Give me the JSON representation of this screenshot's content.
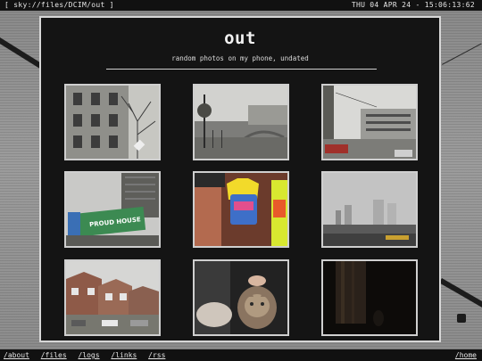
{
  "topbar": {
    "path": "[ sky://files/DCIM/out ]",
    "clock": "THU 04 APR 24 - 15:06:13:62"
  },
  "header": {
    "title": "out",
    "subtitle": "random photos on my phone, undated"
  },
  "photos": [
    {
      "subject": "old building with bare tree"
    },
    {
      "subject": "canal with bridge"
    },
    {
      "subject": "street with buildings"
    },
    {
      "subject": "building with sign",
      "sign_text": "PROUD HOUSE"
    },
    {
      "subject": "shop window with bag"
    },
    {
      "subject": "foggy skyline"
    },
    {
      "subject": "terraced houses street"
    },
    {
      "subject": "cat on lap"
    },
    {
      "subject": "dark room"
    }
  ],
  "nav": {
    "links": [
      "/about",
      "/files",
      "/logs",
      "/links",
      "/rss"
    ],
    "home": "/home"
  },
  "colors": {
    "panel_bg": "#141414",
    "border": "#d7d7d7",
    "bar_bg": "#111111"
  }
}
